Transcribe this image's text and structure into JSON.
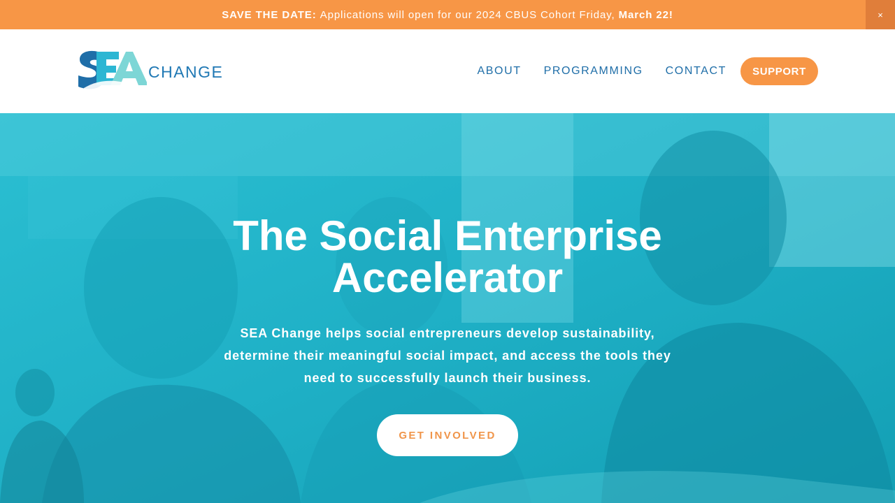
{
  "announcement": {
    "lead": "SAVE THE DATE:",
    "message": "Applications will open for our 2024 CBUS Cohort Friday,",
    "date": "March 22!",
    "close_glyph": "×"
  },
  "header": {
    "logo": {
      "letters": "SEA",
      "word": "CHANGE"
    },
    "nav": [
      {
        "label": "ABOUT"
      },
      {
        "label": "PROGRAMMING"
      },
      {
        "label": "CONTACT"
      }
    ],
    "support_label": "SUPPORT"
  },
  "hero": {
    "title_line1": "The Social Enterprise",
    "title_line2": "Accelerator",
    "subtitle_line1": "SEA Change helps social entrepreneurs develop sustainability,",
    "subtitle_line2": "determine their meaningful social impact, and access the tools they",
    "subtitle_line3": "need to successfully launch their business.",
    "cta_label": "GET INVOLVED"
  },
  "colors": {
    "accent_orange": "#f79646",
    "brand_blue": "#1f6ea8",
    "hero_teal": "#23b3c8"
  }
}
